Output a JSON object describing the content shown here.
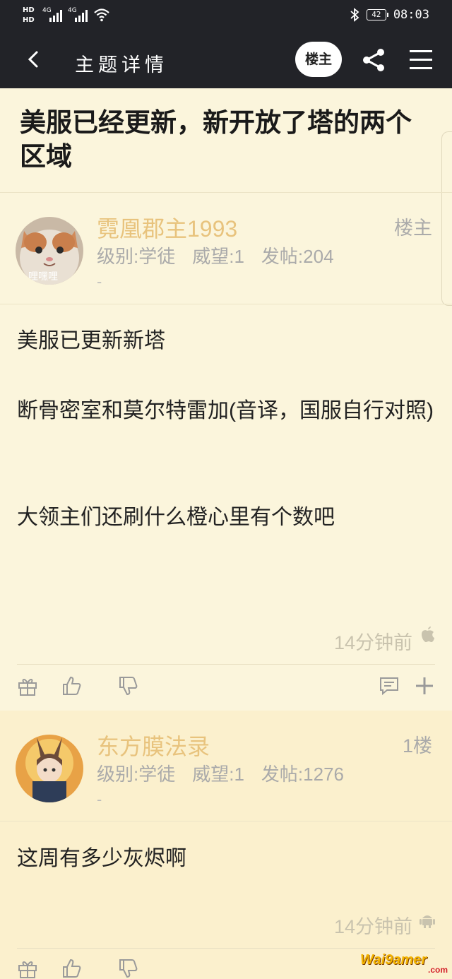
{
  "status_bar": {
    "network1": "4G",
    "network2": "4G",
    "battery": "42",
    "time": "08:03"
  },
  "nav": {
    "title": "主题详情",
    "louzhu_button": "楼主"
  },
  "post": {
    "title": "美服已经更新，新开放了塔的两个区域"
  },
  "posts": [
    {
      "author": "霓凰郡主1993",
      "level": "级别:学徒",
      "prestige": "威望:1",
      "posts_count": "发帖:204",
      "dash": "-",
      "floor": "楼主",
      "lines": [
        "美服已更新新塔",
        "断骨密室和莫尔特雷加(音译，国服自行对照)",
        "大领主们还刷什么橙心里有个数吧"
      ],
      "time": "14分钟前",
      "os_icon": "apple-icon",
      "avatar_caption": "哩嘿哩"
    },
    {
      "author": "东方膜法录",
      "level": "级别:学徒",
      "prestige": "威望:1",
      "posts_count": "发帖:1276",
      "dash": "-",
      "floor": "1楼",
      "lines": [
        "这周有多少灰烬啊"
      ],
      "time": "14分钟前",
      "os_icon": "android-icon"
    }
  ],
  "colors": {
    "nav_bg": "#222328",
    "page_bg": "#fbf5dc",
    "reply_bg": "#fbf0cd",
    "username": "#e8c37d"
  },
  "watermark": {
    "brand": "Wai9amer",
    "domain": ".com"
  }
}
